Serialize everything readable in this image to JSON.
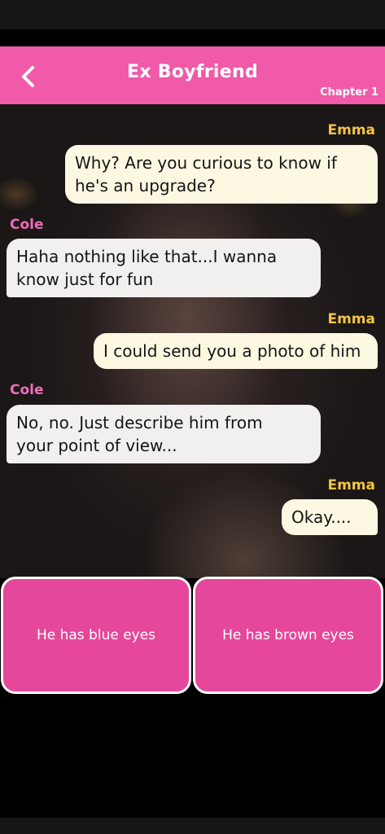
{
  "header": {
    "title": "Ex Boyfriend",
    "chapter": "Chapter 1"
  },
  "messages": [
    {
      "sender": "Emma",
      "line1": "Why? Are you curious to know if",
      "line2": "he's an upgrade?"
    },
    {
      "sender": "Cole",
      "line1": "Haha nothing like that...I wanna",
      "line2": "know just for fun"
    },
    {
      "sender": "Emma",
      "line1": "I could send you a photo of him"
    },
    {
      "sender": "Cole",
      "line1": "No, no. Just describe him from",
      "line2": "your point of view..."
    },
    {
      "sender": "Emma",
      "line1": "Okay...."
    }
  ],
  "choices": [
    {
      "label": "He has blue eyes"
    },
    {
      "label": "He has brown eyes"
    }
  ],
  "colors": {
    "header": "#f05aa8",
    "choice": "#e5479a",
    "emma_name": "#f2c542",
    "cole_name": "#ee6dbd",
    "emma_bubble": "#fdf8e2",
    "cole_bubble": "#f2efef"
  },
  "icons": {
    "back": "chevron-left-icon"
  }
}
